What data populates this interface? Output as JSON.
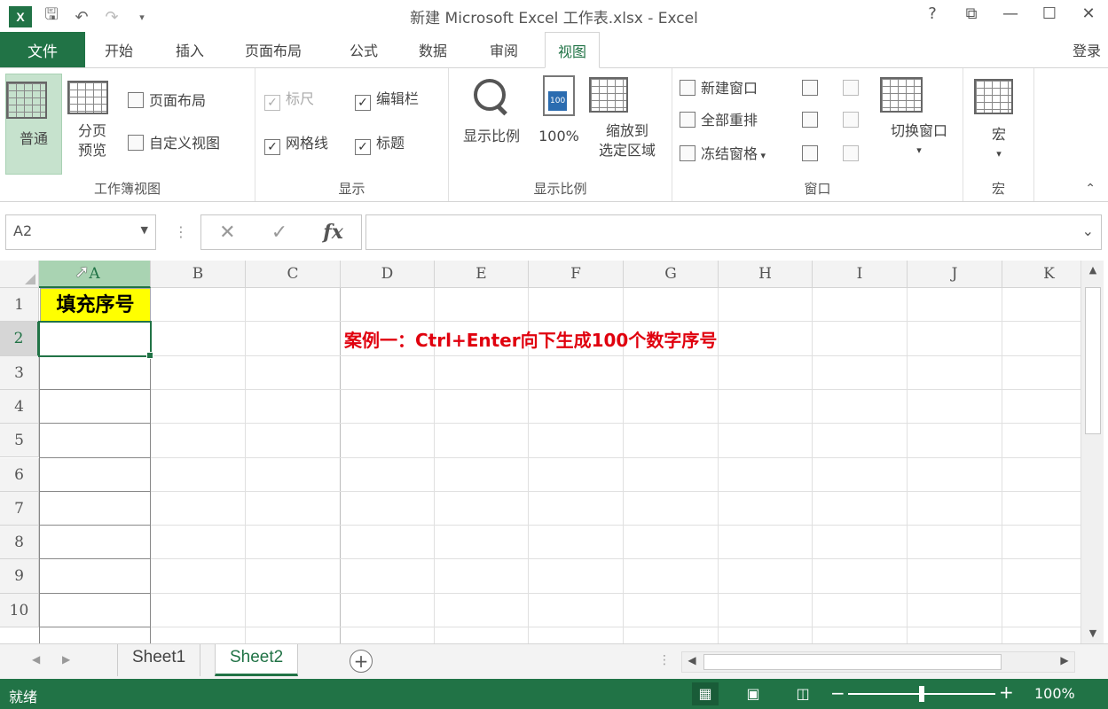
{
  "window": {
    "title": "新建 Microsoft Excel 工作表.xlsx - Excel",
    "logo": "X",
    "controls": {
      "help": "?",
      "restore": "⧉",
      "minimize": "—",
      "maximize": "☐",
      "close": "✕"
    }
  },
  "tabs": {
    "file": "文件",
    "items": [
      "开始",
      "插入",
      "页面布局",
      "公式",
      "数据",
      "审阅",
      "视图"
    ],
    "active": "视图",
    "login": "登录"
  },
  "ribbon": {
    "workbook_views": {
      "label": "工作簿视图",
      "normal": "普通",
      "page_break_1": "分页",
      "page_break_2": "预览",
      "page_layout": "页面布局",
      "custom_views": "自定义视图"
    },
    "show": {
      "label": "显示",
      "ruler": "标尺",
      "formula_bar": "编辑栏",
      "gridlines": "网格线",
      "headings": "标题"
    },
    "zoom": {
      "label": "显示比例",
      "zoom": "显示比例",
      "zoom_100": "100%",
      "zoom_sel_1": "缩放到",
      "zoom_sel_2": "选定区域",
      "icon_badge": "100"
    },
    "window": {
      "label": "窗口",
      "new_window": "新建窗口",
      "arrange_all": "全部重排",
      "freeze_panes": "冻结窗格",
      "switch_windows": "切换窗口"
    },
    "macros": {
      "label": "宏",
      "macros": "宏"
    }
  },
  "formula_bar": {
    "name_box": "A2",
    "fx": "fx",
    "value": ""
  },
  "grid": {
    "columns": [
      "A",
      "B",
      "C",
      "D",
      "E",
      "F",
      "G",
      "H",
      "I",
      "J",
      "K"
    ],
    "rows": [
      "1",
      "2",
      "3",
      "4",
      "5",
      "6",
      "7",
      "8",
      "9",
      "10"
    ],
    "cell_a1": "填充序号",
    "note": "案例一：Ctrl+Enter向下生成100个数字序号",
    "selected_cell": "A2"
  },
  "sheets": {
    "tabs": [
      "Sheet1",
      "Sheet2"
    ],
    "active": "Sheet2",
    "add": "+"
  },
  "status": {
    "ready": "就绪",
    "zoom": "100%",
    "zoom_level": 0.5
  }
}
